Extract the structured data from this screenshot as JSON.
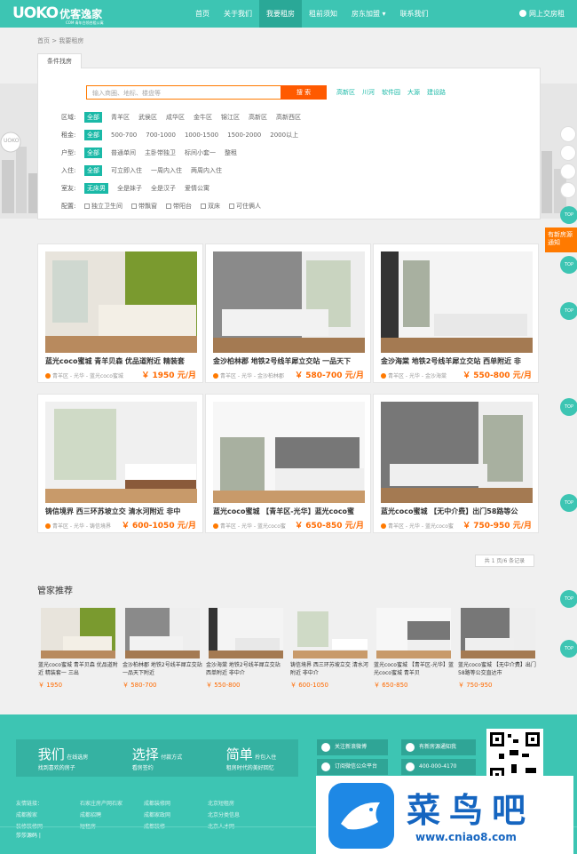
{
  "header": {
    "logo_en": "UOKO",
    "logo_cn": "优客逸家",
    "logo_sub": "COM 青年白领合租公寓",
    "login": "网上交房租",
    "nav": [
      "首页",
      "关于我们",
      "我要租房",
      "租前须知",
      "房东加盟 ▾",
      "联系我们"
    ]
  },
  "breadcrumb": "首页 > 我要租房",
  "tab_label": "条件找房",
  "search": {
    "placeholder": "输入商圈、地标、楼盘等",
    "button": "搜 索",
    "hot": [
      "高新区",
      "川河",
      "软件园",
      "大源",
      "建设路"
    ]
  },
  "filters": [
    {
      "label": "区域:",
      "options": [
        "全部",
        "青羊区",
        "武侯区",
        "成华区",
        "金牛区",
        "锦江区",
        "高新区",
        "高新西区"
      ]
    },
    {
      "label": "租金:",
      "options": [
        "全部",
        "500-700",
        "700-1000",
        "1000-1500",
        "1500-2000",
        "2000以上"
      ]
    },
    {
      "label": "户型:",
      "options": [
        "全部",
        "普通单间",
        "主卧带独卫",
        "标间小套一",
        "整租"
      ]
    },
    {
      "label": "入住:",
      "options": [
        "全部",
        "可立即入住",
        "一周内入住",
        "两周内入住"
      ]
    },
    {
      "label": "室友:",
      "options": [
        "无床男",
        "全是妹子",
        "全是汉子",
        "爱情公寓"
      ]
    }
  ],
  "config": {
    "label": "配置:",
    "options": [
      "独立卫生间",
      "带飘窗",
      "带阳台",
      "双床",
      "可住俩人"
    ]
  },
  "listings": [
    {
      "title": "蓝光coco蜜城 青羊贝森 优品道附近 精装套",
      "loc": "青羊区 - 光华 - 蓝光coco蜜城",
      "price": "￥ 1950 元/月"
    },
    {
      "title": "金沙柏林郡 地铁2号线羊犀立交站 一品天下",
      "loc": "青羊区 - 光华 - 金沙柏林郡",
      "price": "￥ 580-700 元/月"
    },
    {
      "title": "金沙海棠 地铁2号线羊犀立交站 西单附近 非",
      "loc": "青羊区 - 光华 - 金沙海棠",
      "price": "￥ 550-800 元/月"
    },
    {
      "title": "铸信境界 西三环苏坡立交 清水河附近 非中",
      "loc": "青羊区 - 光华 - 铸信境界",
      "price": "￥ 600-1050 元/月"
    },
    {
      "title": "蓝光coco蜜城 【青羊区-光华】蓝光coco蜜",
      "loc": "青羊区 - 光华 - 蓝光coco蜜",
      "price": "￥ 650-850 元/月"
    },
    {
      "title": "蓝光coco蜜城 【无中介费】出门58路等公",
      "loc": "青羊区 - 光华 - 蓝光coco蜜",
      "price": "￥ 750-950 元/月"
    }
  ],
  "pager": "共 1 页/6 条记录",
  "recommend": {
    "title": "管家推荐",
    "items": [
      {
        "title": "蓝光coco蜜城 青羊贝森 优品道附近 精装套一 三出",
        "price": "￥ 1950"
      },
      {
        "title": "金沙柏林郡 地铁2号线羊犀立交站 一品天下附近",
        "price": "￥ 580-700"
      },
      {
        "title": "金沙海棠 地铁2号线羊犀立交站 西单附近 非中介",
        "price": "￥ 550-800"
      },
      {
        "title": "铸信境界 西三环苏坡立交 清水河附近 非中介",
        "price": "￥ 600-1050"
      },
      {
        "title": "蓝光coco蜜城 【青羊区-光华】蓝光coco蜜城 青羊贝",
        "price": "￥ 650-850"
      },
      {
        "title": "蓝光coco蜜城 【无中介费】出门58路等公交直达市",
        "price": "￥ 750-950"
      }
    ]
  },
  "footer": {
    "slogan": [
      {
        "big": "我们",
        "small1": "在线选房",
        "small2": "找到喜欢的房子"
      },
      {
        "big": "选择",
        "small1": "付款方式",
        "small2": "看房签约"
      },
      {
        "big": "简单",
        "small1": "拎包入住",
        "small2": "租房时代的美好回忆"
      }
    ],
    "buttons": [
      "关注新浪微博",
      "有新房源通知我",
      "订阅微信公众平台",
      "400-000-4170"
    ],
    "links": [
      "友情链接：",
      "石家庄房产网石家",
      "成都装修网",
      "北京短租房",
      "成都搬家",
      "成都招聘",
      "成都家政网",
      "北京分类信息",
      "装修装修网",
      "短租房",
      "成都装修",
      "北京人才网"
    ],
    "copyright": "莎莎源码 |"
  },
  "watermark": {
    "brand": "菜鸟吧",
    "url": "www.cniao8.com"
  },
  "side": {
    "top": "TOP",
    "promo": "有新房源通知"
  }
}
